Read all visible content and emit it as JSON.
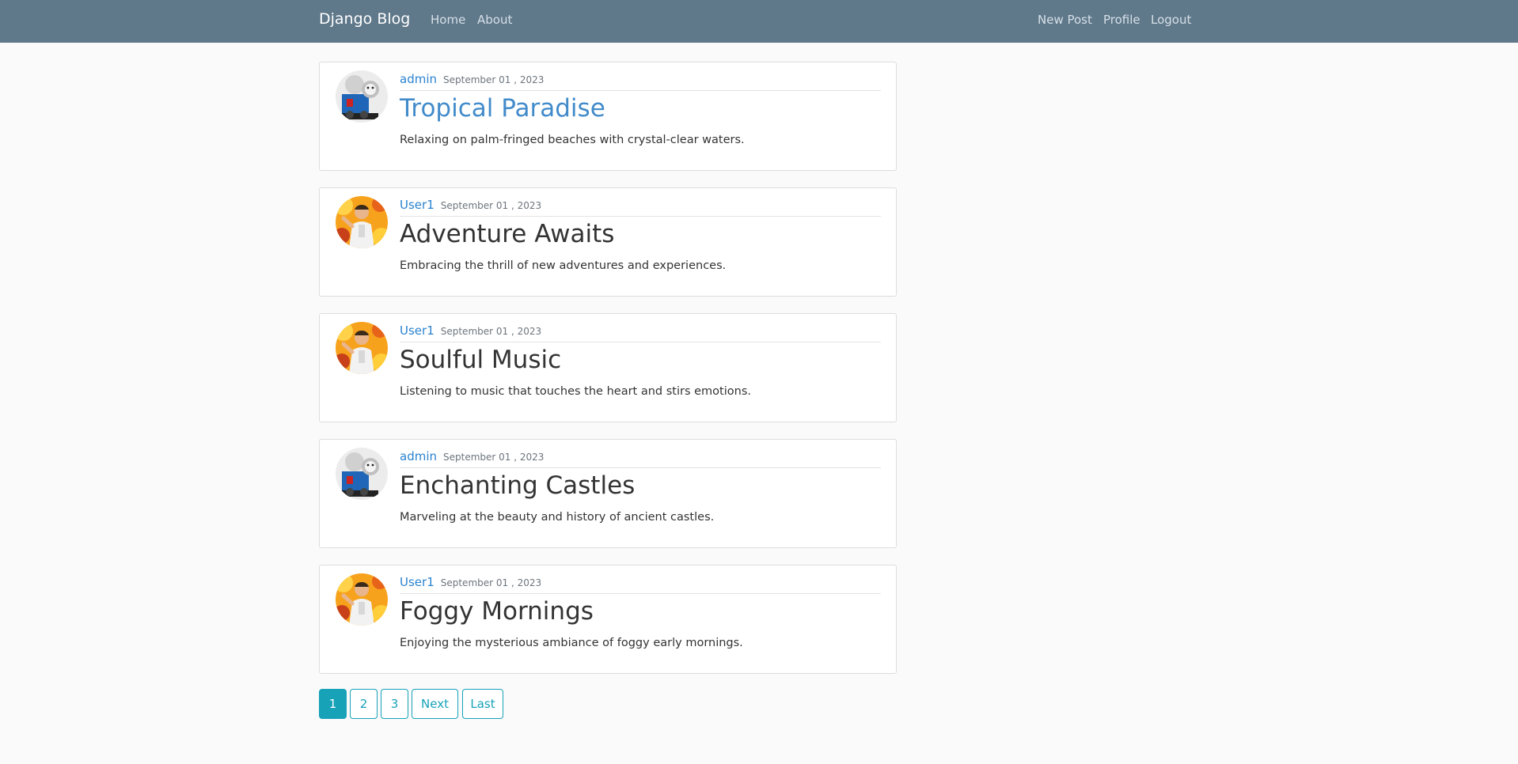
{
  "navbar": {
    "brand": "Django Blog",
    "left_links": [
      "Home",
      "About"
    ],
    "right_links": [
      "New Post",
      "Profile",
      "Logout"
    ]
  },
  "posts": [
    {
      "author": "admin",
      "date": "September 01 , 2023",
      "title": "Tropical Paradise",
      "content": "Relaxing on palm-fringed beaches with crystal-clear waters.",
      "avatar": "train-avatar-icon"
    },
    {
      "author": "User1",
      "date": "September 01 , 2023",
      "title": "Adventure Awaits",
      "content": "Embracing the thrill of new adventures and experiences.",
      "avatar": "person-avatar-icon"
    },
    {
      "author": "User1",
      "date": "September 01 , 2023",
      "title": "Soulful Music",
      "content": "Listening to music that touches the heart and stirs emotions.",
      "avatar": "person-avatar-icon"
    },
    {
      "author": "admin",
      "date": "September 01 , 2023",
      "title": "Enchanting Castles",
      "content": "Marveling at the beauty and history of ancient castles.",
      "avatar": "train-avatar-icon"
    },
    {
      "author": "User1",
      "date": "September 01 , 2023",
      "title": "Foggy Mornings",
      "content": "Enjoying the mysterious ambiance of foggy early mornings.",
      "avatar": "person-avatar-icon"
    }
  ],
  "pagination": {
    "items": [
      "1",
      "2",
      "3",
      "Next",
      "Last"
    ],
    "active": "1"
  },
  "colors": {
    "navbar": "#5f788a",
    "accent": "#17a2b8",
    "link": "#2a83cf",
    "active_title": "#428bca"
  }
}
